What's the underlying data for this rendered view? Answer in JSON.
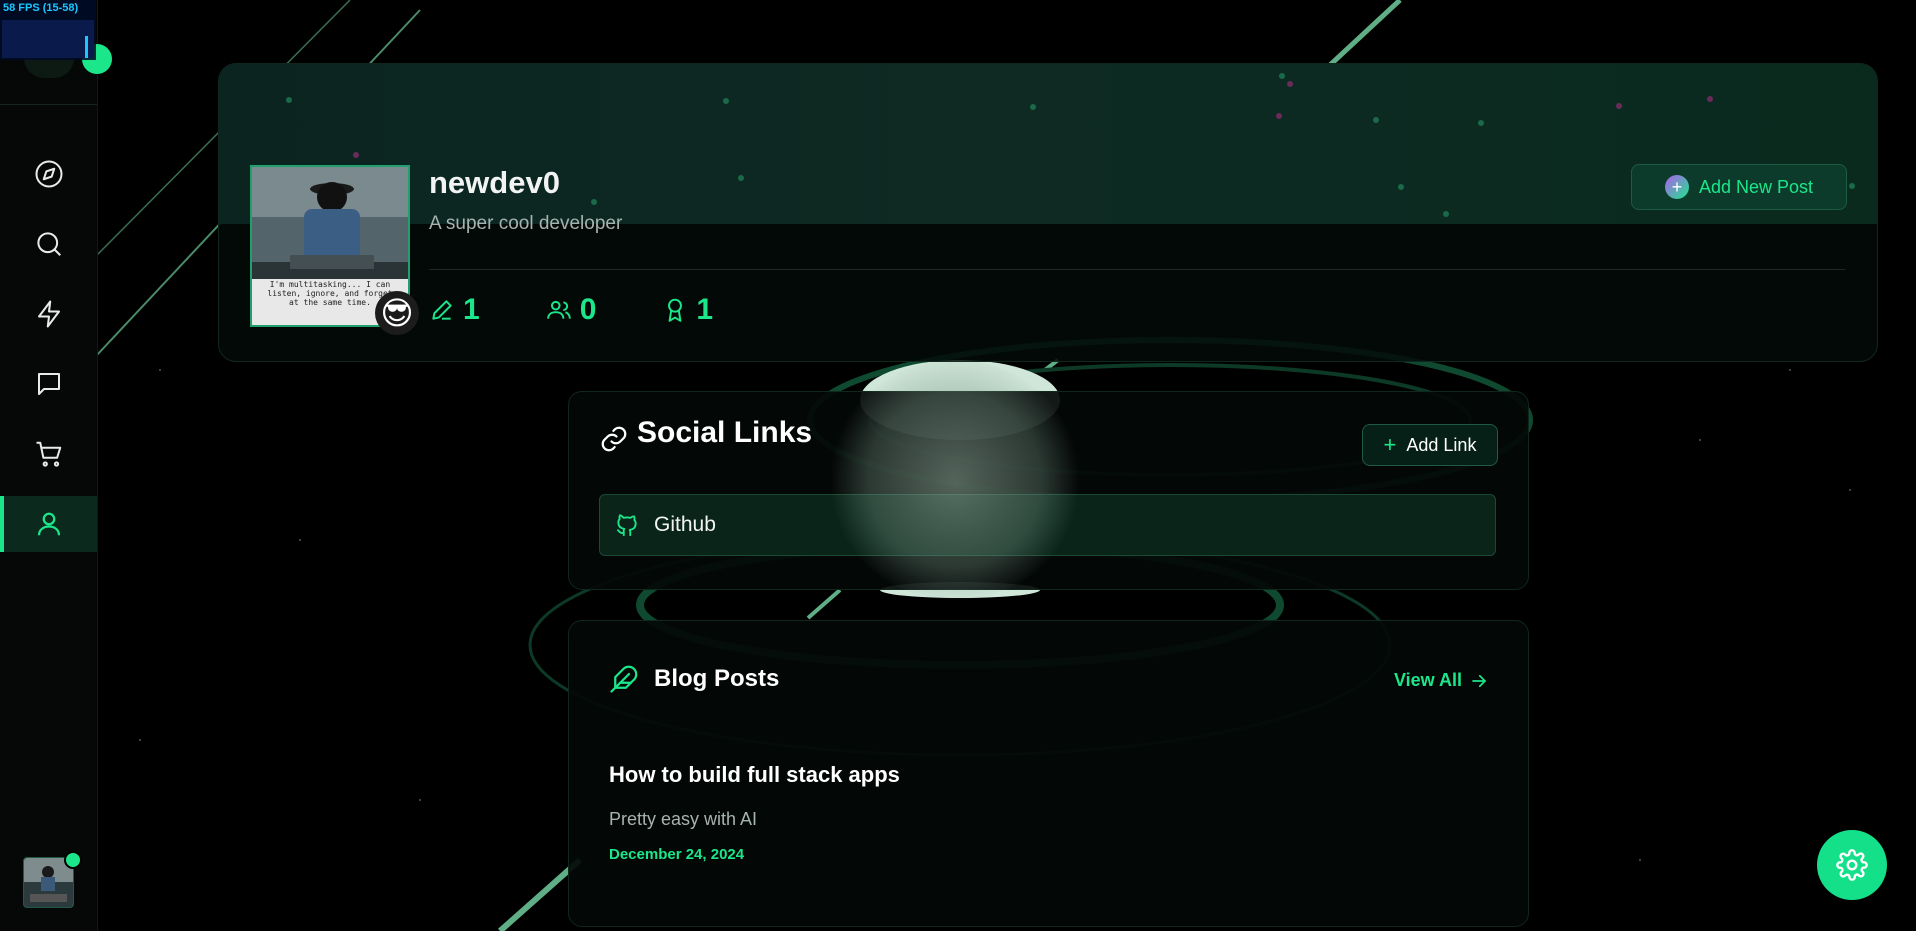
{
  "fps": {
    "label": "58 FPS (15-58)"
  },
  "sidebar": {
    "items": [
      {
        "name": "explore",
        "icon": "compass-icon"
      },
      {
        "name": "search",
        "icon": "search-icon"
      },
      {
        "name": "activity",
        "icon": "lightning-icon"
      },
      {
        "name": "messages",
        "icon": "chat-icon"
      },
      {
        "name": "cart",
        "icon": "cart-icon"
      },
      {
        "name": "profile",
        "icon": "user-icon",
        "active": true
      }
    ]
  },
  "profile": {
    "username": "newdev0",
    "bio": "A super cool developer",
    "avatar_caption": "I'm multitasking... I can listen, ignore, and forget at the same time.",
    "emoji": "😎",
    "add_post_label": "Add New Post",
    "stats": {
      "posts": "1",
      "followers": "0",
      "achievements": "1"
    }
  },
  "social": {
    "title": "Social Links",
    "add_label": "Add Link",
    "links": [
      {
        "label": "Github",
        "icon": "github-icon"
      }
    ]
  },
  "blog": {
    "title": "Blog Posts",
    "view_all": "View All",
    "posts": [
      {
        "title": "How to build full stack apps",
        "excerpt": "Pretty easy with AI",
        "date": "December 24, 2024"
      }
    ]
  },
  "colors": {
    "accent": "#1be78a",
    "background": "#000000",
    "panel": "#04100b"
  }
}
